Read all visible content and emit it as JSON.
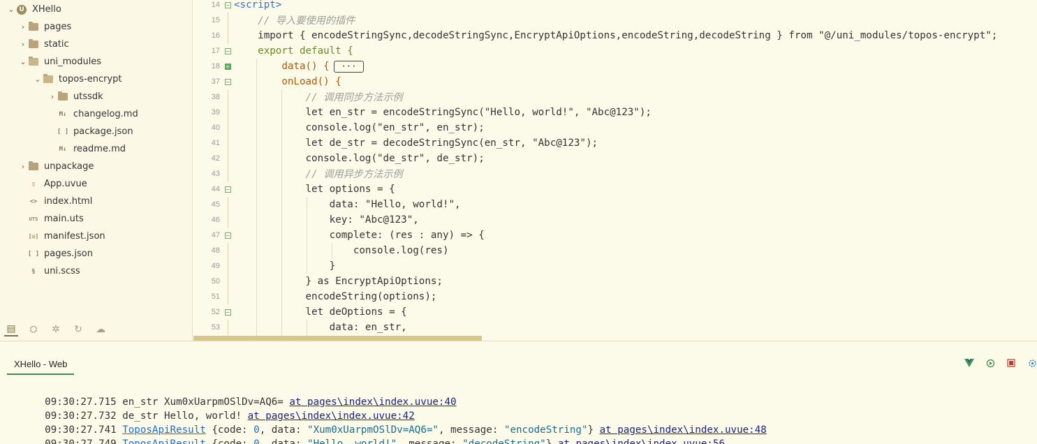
{
  "sidebar": {
    "items": [
      {
        "label": "XHello",
        "icon": "project-icon"
      },
      {
        "label": "pages",
        "icon": "folder-icon"
      },
      {
        "label": "static",
        "icon": "folder-icon"
      },
      {
        "label": "uni_modules",
        "icon": "folder-open-icon"
      },
      {
        "label": "topos-encrypt",
        "icon": "folder-open-icon"
      },
      {
        "label": "utssdk",
        "icon": "folder-icon"
      },
      {
        "label": "changelog.md",
        "icon": "markdown-file-icon",
        "badge": "M↓"
      },
      {
        "label": "package.json",
        "icon": "json-file-icon",
        "badge": "[ ]"
      },
      {
        "label": "readme.md",
        "icon": "markdown-file-icon",
        "badge": "M↓"
      },
      {
        "label": "unpackage",
        "icon": "folder-icon"
      },
      {
        "label": "App.uvue",
        "icon": "vue-file-icon",
        "badge": "▯"
      },
      {
        "label": "index.html",
        "icon": "html-file-icon",
        "badge": "<>"
      },
      {
        "label": "main.uts",
        "icon": "uts-file-icon",
        "badge": "UTS"
      },
      {
        "label": "manifest.json",
        "icon": "manifest-file-icon",
        "badge": "[◎]"
      },
      {
        "label": "pages.json",
        "icon": "json-file-icon",
        "badge": "[ ]"
      },
      {
        "label": "uni.scss",
        "icon": "scss-file-icon",
        "badge": "§"
      }
    ],
    "footer_tabs": [
      "files-tab-icon",
      "plugins-tab-icon",
      "debug-tab-icon",
      "git-tab-icon",
      "cloud-tab-icon"
    ]
  },
  "editor": {
    "lines": [
      {
        "n": "14",
        "text": "<script>"
      },
      {
        "n": "15",
        "text": "    // 导入要使用的插件"
      },
      {
        "n": "16",
        "text": "    import { encodeStringSync,decodeStringSync,EncryptApiOptions,encodeString,decodeString } from \"@/uni_modules/topos-encrypt\";"
      },
      {
        "n": "17",
        "text": "    export default {"
      },
      {
        "n": "18",
        "text": "        data() {",
        "collapsed": "···"
      },
      {
        "n": "37",
        "text": "        onLoad() {"
      },
      {
        "n": "38",
        "text": "            // 调用同步方法示例"
      },
      {
        "n": "39",
        "text": "            let en_str = encodeStringSync(\"Hello, world!\", \"Abc@123\");"
      },
      {
        "n": "40",
        "text": "            console.log(\"en_str\", en_str);"
      },
      {
        "n": "41",
        "text": "            let de_str = decodeStringSync(en_str, \"Abc@123\");"
      },
      {
        "n": "42",
        "text": "            console.log(\"de_str\", de_str);"
      },
      {
        "n": "43",
        "text": "            // 调用异步方法示例"
      },
      {
        "n": "44",
        "text": "            let options = {"
      },
      {
        "n": "45",
        "text": "                data: \"Hello, world!\","
      },
      {
        "n": "46",
        "text": "                key: \"Abc@123\","
      },
      {
        "n": "47",
        "text": "                complete: (res : any) => {"
      },
      {
        "n": "48",
        "text": "                    console.log(res)"
      },
      {
        "n": "49",
        "text": "                }"
      },
      {
        "n": "50",
        "text": "            } as EncryptApiOptions;"
      },
      {
        "n": "51",
        "text": "            encodeString(options);"
      },
      {
        "n": "52",
        "text": "            let deOptions = {"
      },
      {
        "n": "53",
        "text": "                data: en_str,"
      }
    ]
  },
  "console": {
    "tab_label": "XHello - Web",
    "tools": [
      "vue-devtools-icon",
      "restart-icon",
      "stop-icon",
      "settings-icon"
    ],
    "logs": [
      {
        "time": "09:30:27.715",
        "msg": " en_str Xum0xUarpmOSlDv=AQ6= ",
        "link": "at pages\\index\\index.uvue:40"
      },
      {
        "time": "09:30:27.732",
        "msg": " de_str Hello, world! ",
        "link": "at pages\\index\\index.uvue:42"
      },
      {
        "time": "09:30:27.741",
        "type": "ToposApiResult",
        "code": "0",
        "data": "\"Xum0xUarpmOSlDv=AQ6=\"",
        "message": "\"encodeString\"",
        "link": "at pages\\index\\index.uvue:48"
      },
      {
        "time": "09:30:27.749",
        "type": "ToposApiResult",
        "code": "0",
        "data": "\"Hello, world!\"",
        "message": "\"decodeString\"",
        "link": "at pages\\index\\index.uvue:56"
      }
    ]
  }
}
